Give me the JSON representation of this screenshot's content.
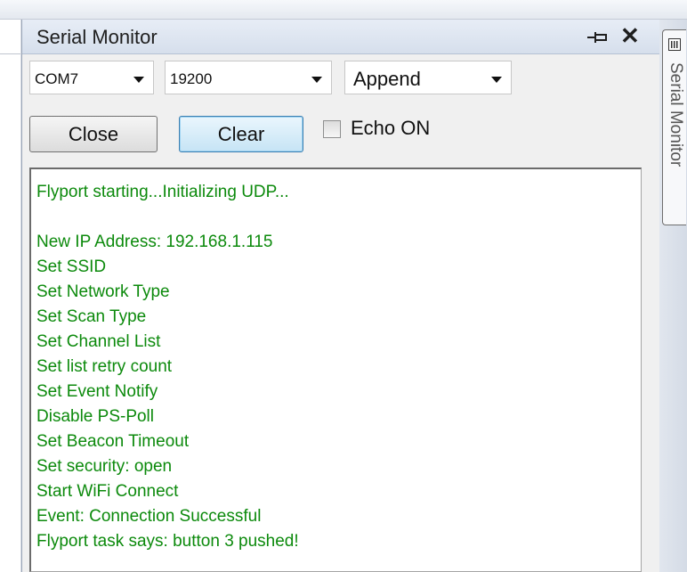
{
  "window": {
    "title": "Serial Monitor",
    "side_tab_label": "Serial Monitor"
  },
  "controls": {
    "port": "COM7",
    "baud": "19200",
    "line_mode": "Append",
    "close_label": "Close",
    "clear_label": "Clear",
    "echo_label": "Echo ON",
    "echo_checked": false
  },
  "output": {
    "text_color": "#0c8a0c",
    "lines": [
      "Flyport starting...Initializing UDP...",
      "",
      "New IP Address: 192.168.1.115",
      "Set SSID",
      "Set Network Type",
      "Set Scan Type",
      "Set Channel List",
      "Set list retry count",
      "Set Event Notify",
      "Disable PS-Poll",
      "Set Beacon Timeout",
      "Set security: open",
      "Start WiFi Connect",
      "Event: Connection Successful",
      "Flyport task says: button 3 pushed!"
    ]
  },
  "icons": {
    "pin": "pin-icon",
    "close": "close-icon",
    "tab": "serial-monitor-tab-icon"
  }
}
